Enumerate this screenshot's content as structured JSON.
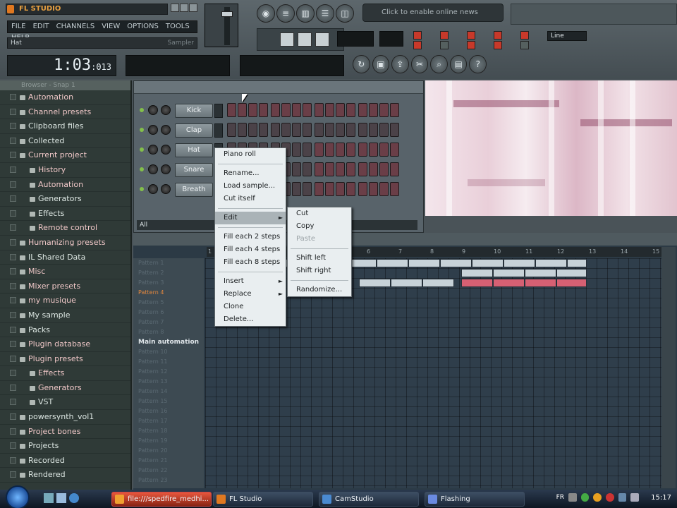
{
  "app": {
    "title": "FL STUDIO",
    "window_buttons": [
      "_",
      "□",
      "×"
    ]
  },
  "menu": [
    "FILE",
    "EDIT",
    "CHANNELS",
    "VIEW",
    "OPTIONS",
    "TOOLS",
    "HELP"
  ],
  "hint": {
    "left": "Hat",
    "right": "Sampler"
  },
  "time": {
    "main": "1:03",
    "sub": ":013"
  },
  "news": "Click to enable online news",
  "pattern_mode": "Line",
  "browser": {
    "header": "Browser - Snap 1",
    "items": [
      {
        "label": "Automation",
        "sub": false,
        "hl": true
      },
      {
        "label": "Channel presets",
        "sub": false,
        "hl": true
      },
      {
        "label": "Clipboard files",
        "sub": false,
        "hl": false
      },
      {
        "label": "Collected",
        "sub": false,
        "hl": false
      },
      {
        "label": "Current project",
        "sub": false,
        "hl": true
      },
      {
        "label": "History",
        "sub": true,
        "hl": true
      },
      {
        "label": "Automation",
        "sub": true,
        "hl": true
      },
      {
        "label": "Generators",
        "sub": true,
        "hl": false
      },
      {
        "label": "Effects",
        "sub": true,
        "hl": false
      },
      {
        "label": "Remote control",
        "sub": true,
        "hl": true
      },
      {
        "label": "Humanizing presets",
        "sub": false,
        "hl": true
      },
      {
        "label": "IL Shared Data",
        "sub": false,
        "hl": false
      },
      {
        "label": "Misc",
        "sub": false,
        "hl": true
      },
      {
        "label": "Mixer presets",
        "sub": false,
        "hl": true
      },
      {
        "label": "my musique",
        "sub": false,
        "hl": true
      },
      {
        "label": "My sample",
        "sub": false,
        "hl": false
      },
      {
        "label": "Packs",
        "sub": false,
        "hl": false
      },
      {
        "label": "Plugin database",
        "sub": false,
        "hl": true
      },
      {
        "label": "Plugin presets",
        "sub": false,
        "hl": true
      },
      {
        "label": "Effects",
        "sub": true,
        "hl": true
      },
      {
        "label": "Generators",
        "sub": true,
        "hl": true
      },
      {
        "label": "VST",
        "sub": true,
        "hl": false
      },
      {
        "label": "powersynth_vol1",
        "sub": false,
        "hl": false
      },
      {
        "label": "Project bones",
        "sub": false,
        "hl": true
      },
      {
        "label": "Projects",
        "sub": false,
        "hl": false
      },
      {
        "label": "Recorded",
        "sub": false,
        "hl": false
      },
      {
        "label": "Rendered",
        "sub": false,
        "hl": false
      }
    ]
  },
  "channels": [
    {
      "name": "Kick",
      "steps": [
        1,
        1,
        1,
        1,
        1,
        1,
        1,
        1,
        1,
        1,
        1,
        1,
        1,
        1,
        1,
        1
      ]
    },
    {
      "name": "Clap",
      "steps": [
        0,
        0,
        0,
        0,
        0,
        0,
        0,
        0,
        0,
        0,
        0,
        0,
        0,
        0,
        0,
        0
      ]
    },
    {
      "name": "Hat",
      "steps": [
        0,
        0,
        0,
        0,
        0,
        0,
        0,
        0,
        1,
        1,
        1,
        1,
        1,
        1,
        1,
        1
      ]
    },
    {
      "name": "Snare",
      "steps": [
        0,
        0,
        0,
        0,
        0,
        0,
        0,
        0,
        1,
        1,
        1,
        1,
        1,
        1,
        1,
        1
      ]
    },
    {
      "name": "Breath",
      "steps": [
        0,
        0,
        0,
        0,
        0,
        0,
        0,
        0,
        1,
        1,
        1,
        1,
        1,
        1,
        1,
        1
      ]
    }
  ],
  "channel_filter": "All",
  "ruler": [
    "1",
    "2",
    "3",
    "4",
    "5",
    "6",
    "7",
    "8",
    "9",
    "10",
    "11",
    "12",
    "13",
    "14",
    "15"
  ],
  "patterns": [
    "Pattern 1",
    "Pattern 2",
    "Pattern 3",
    "Pattern 4",
    "Pattern 5",
    "Pattern 6",
    "Pattern 7",
    "Pattern 8",
    "Main automation",
    "Pattern 10",
    "Pattern 11",
    "Pattern 12",
    "Pattern 13",
    "Pattern 14",
    "Pattern 15",
    "Pattern 16",
    "Pattern 17",
    "Pattern 18",
    "Pattern 19",
    "Pattern 20",
    "Pattern 21",
    "Pattern 22",
    "Pattern 23"
  ],
  "context_menu": [
    {
      "label": "Piano roll",
      "type": "item"
    },
    {
      "type": "sep"
    },
    {
      "label": "Rename...",
      "type": "item"
    },
    {
      "label": "Load sample...",
      "type": "item"
    },
    {
      "label": "Cut itself",
      "type": "item"
    },
    {
      "type": "sep"
    },
    {
      "label": "Edit",
      "type": "sub",
      "selected": true
    },
    {
      "type": "sep"
    },
    {
      "label": "Fill each 2 steps",
      "type": "item"
    },
    {
      "label": "Fill each 4 steps",
      "type": "item"
    },
    {
      "label": "Fill each 8 steps",
      "type": "item"
    },
    {
      "type": "sep"
    },
    {
      "label": "Insert",
      "type": "sub"
    },
    {
      "label": "Replace",
      "type": "sub"
    },
    {
      "label": "Clone",
      "type": "item"
    },
    {
      "label": "Delete...",
      "type": "item"
    }
  ],
  "edit_submenu": [
    {
      "label": "Cut",
      "type": "item"
    },
    {
      "label": "Copy",
      "type": "item"
    },
    {
      "label": "Paste",
      "type": "item",
      "disabled": true
    },
    {
      "type": "sep"
    },
    {
      "label": "Shift left",
      "type": "item"
    },
    {
      "label": "Shift right",
      "type": "item"
    },
    {
      "type": "sep"
    },
    {
      "label": "Randomize...",
      "type": "item"
    }
  ],
  "taskbar": {
    "tasks": [
      {
        "label": "file:///spedfire_medhi...",
        "active": true,
        "color": "#f0a030"
      },
      {
        "label": "FL Studio",
        "active": false,
        "color": "#e07820"
      },
      {
        "label": "CamStudio",
        "active": false,
        "color": "#4a8ad0"
      },
      {
        "label": "Flashing",
        "active": false,
        "color": "#6a8ae0"
      }
    ],
    "lang": "FR",
    "clock": "15:17"
  }
}
